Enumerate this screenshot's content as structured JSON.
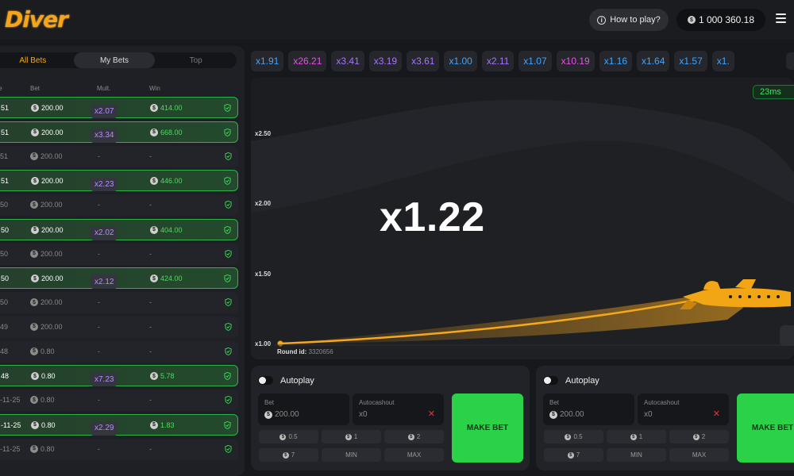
{
  "header": {
    "logo": "Diver",
    "how_to_play": "How to play?",
    "balance": "1 000 360.18",
    "coin_symbol": "$"
  },
  "left": {
    "tabs": [
      "All Bets",
      "My Bets",
      "Top"
    ],
    "columns": [
      "te",
      "Bet",
      "Mult.",
      "Win"
    ],
    "rows": [
      {
        "time": "51",
        "bet": "200.00",
        "mult": "x2.07",
        "win": "414.00",
        "won": true
      },
      {
        "time": "51",
        "bet": "200.00",
        "mult": "x3.34",
        "win": "668.00",
        "won": true
      },
      {
        "time": "51",
        "bet": "200.00",
        "mult": "-",
        "win": "-",
        "won": false
      },
      {
        "time": "51",
        "bet": "200.00",
        "mult": "x2.23",
        "win": "446.00",
        "won": true
      },
      {
        "time": "50",
        "bet": "200.00",
        "mult": "-",
        "win": "-",
        "won": false
      },
      {
        "time": "50",
        "bet": "200.00",
        "mult": "x2.02",
        "win": "404.00",
        "won": true
      },
      {
        "time": "50",
        "bet": "200.00",
        "mult": "-",
        "win": "-",
        "won": false
      },
      {
        "time": "50",
        "bet": "200.00",
        "mult": "x2.12",
        "win": "424.00",
        "won": true
      },
      {
        "time": "50",
        "bet": "200.00",
        "mult": "-",
        "win": "-",
        "won": false
      },
      {
        "time": "49",
        "bet": "200.00",
        "mult": "-",
        "win": "-",
        "won": false
      },
      {
        "time": "48",
        "bet": "0.80",
        "mult": "-",
        "win": "-",
        "won": false
      },
      {
        "time": "48",
        "bet": "0.80",
        "mult": "x7.23",
        "win": "5.78",
        "won": true
      },
      {
        "time": "-11-25",
        "bet": "0.80",
        "mult": "-",
        "win": "-",
        "won": false
      },
      {
        "time": "-11-25",
        "bet": "0.80",
        "mult": "x2.29",
        "win": "1.83",
        "won": true
      },
      {
        "time": "-11-25",
        "bet": "0.80",
        "mult": "-",
        "win": "-",
        "won": false
      }
    ]
  },
  "history": [
    {
      "label": "x1.91",
      "color": "#3fa5ff"
    },
    {
      "label": "x26.21",
      "color": "#e452e4"
    },
    {
      "label": "x3.41",
      "color": "#a474ff"
    },
    {
      "label": "x3.19",
      "color": "#a474ff"
    },
    {
      "label": "x3.61",
      "color": "#a474ff"
    },
    {
      "label": "x1.00",
      "color": "#3fa5ff"
    },
    {
      "label": "x2.11",
      "color": "#a474ff"
    },
    {
      "label": "x1.07",
      "color": "#3fa5ff"
    },
    {
      "label": "x10.19",
      "color": "#e452e4"
    },
    {
      "label": "x1.16",
      "color": "#3fa5ff"
    },
    {
      "label": "x1.64",
      "color": "#3fa5ff"
    },
    {
      "label": "x1.57",
      "color": "#3fa5ff"
    },
    {
      "label": "x1.",
      "color": "#3fa5ff"
    }
  ],
  "game": {
    "ping": "23ms",
    "multiplier": "x1.22",
    "y_labels": [
      "x2.50",
      "x2.00",
      "x1.50",
      "x1.00"
    ],
    "round_label": "Round id:",
    "round_id": "3320656"
  },
  "bet_panels": [
    {
      "autoplay": "Autoplay",
      "bet_label": "Bet",
      "bet_value": "200.00",
      "autocashout_label": "Autocashout",
      "autocashout_value": "x0",
      "quick": [
        "0.5",
        "1",
        "2",
        "7",
        "MIN",
        "MAX"
      ],
      "make_bet": "MAKE BET"
    },
    {
      "autoplay": "Autoplay",
      "bet_label": "Bet",
      "bet_value": "200.00",
      "autocashout_label": "Autocashout",
      "autocashout_value": "x0",
      "quick": [
        "0.5",
        "1",
        "2",
        "7",
        "MIN",
        "MAX"
      ],
      "make_bet": "MAKE BET"
    }
  ]
}
